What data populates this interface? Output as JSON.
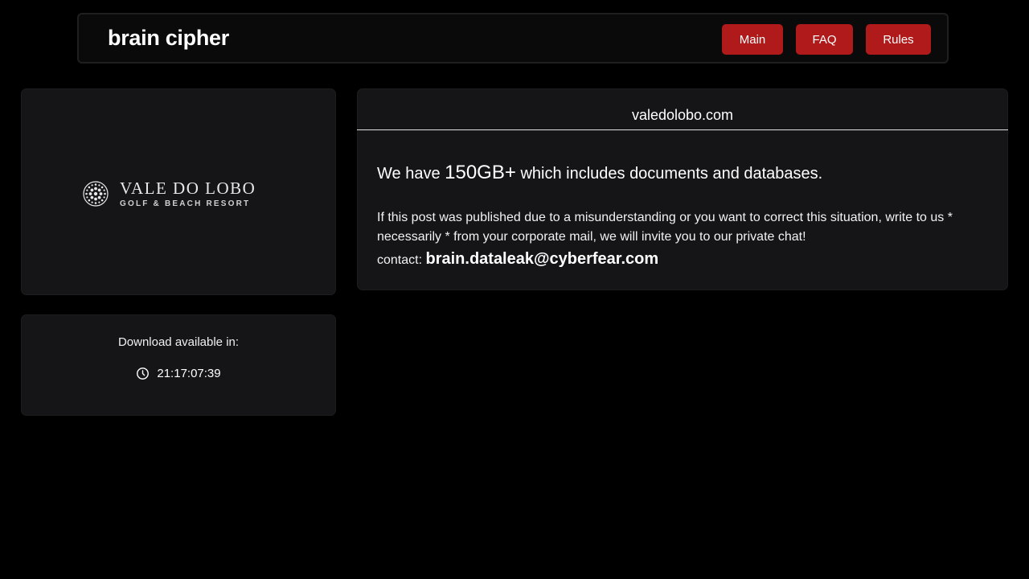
{
  "header": {
    "brand": "brain cipher",
    "nav": [
      {
        "label": "Main"
      },
      {
        "label": "FAQ"
      },
      {
        "label": "Rules"
      }
    ]
  },
  "logo_card": {
    "logo_line1": "VALE DO LOBO",
    "logo_line2": "GOLF & BEACH RESORT"
  },
  "countdown": {
    "label": "Download available in:",
    "icon": "clock-icon",
    "time": "21:17:07:39"
  },
  "info": {
    "site": "valedolobo.com",
    "we_have": "We have",
    "size": "150GB+",
    "includes": "which includes documents and databases.",
    "description": "If this post was published due to a misunderstanding or you want to correct this situation, write to us * necessarily * from your corporate mail, we will invite you to our private chat!",
    "contact_label": "contact:",
    "contact_email": "brain.dataleak@cyberfear.com"
  },
  "colors": {
    "background": "#000000",
    "card": "#151517",
    "accent_button": "#b01a1a"
  }
}
